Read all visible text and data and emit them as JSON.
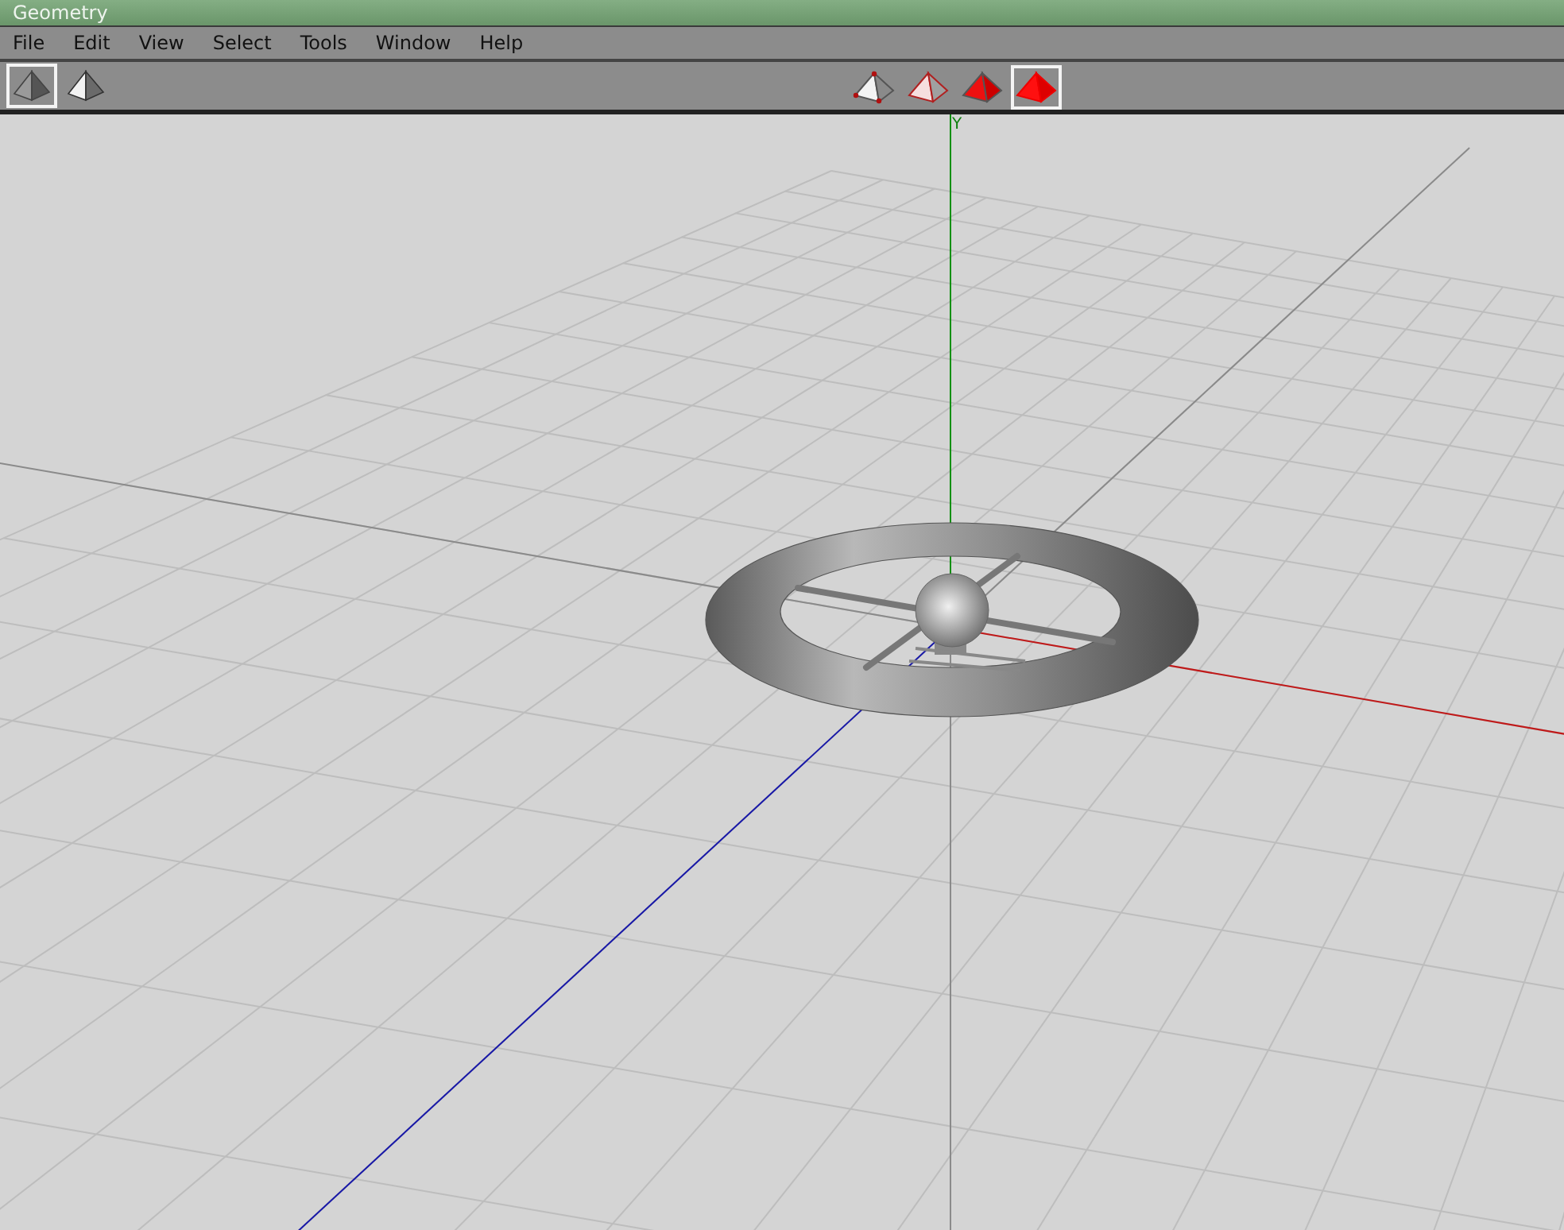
{
  "window": {
    "title": "Geometry"
  },
  "menu": [
    "File",
    "Edit",
    "View",
    "Select",
    "Tools",
    "Window",
    "Help"
  ],
  "display_tools": [
    {
      "kind": "shaded",
      "selected": true
    },
    {
      "kind": "flat",
      "selected": false
    }
  ],
  "selection_tools": [
    {
      "kind": "vertex",
      "selected": false
    },
    {
      "kind": "edge",
      "selected": false
    },
    {
      "kind": "face",
      "selected": false
    },
    {
      "kind": "object",
      "selected": true
    }
  ],
  "viewport": {
    "axis_label": "Y"
  }
}
